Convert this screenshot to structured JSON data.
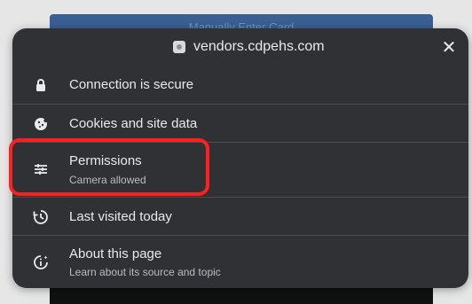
{
  "background": {
    "top_button_label": "Manually Enter Card"
  },
  "popup": {
    "site_name": "vendors.cdpehs.com",
    "close_icon": "close-icon",
    "rows": [
      {
        "title": "Connection is secure",
        "subtitle": ""
      },
      {
        "title": "Cookies and site data",
        "subtitle": ""
      },
      {
        "title": "Permissions",
        "subtitle": "Camera allowed"
      },
      {
        "title": "Last visited today",
        "subtitle": ""
      },
      {
        "title": "About this page",
        "subtitle": "Learn about its source and topic"
      }
    ]
  },
  "colors": {
    "popup_bg": "#303134",
    "text_primary": "#e8eaed",
    "text_secondary": "#b9bcc1",
    "divider": "#4a4c50",
    "highlight": "#ff2020",
    "background_blue": "#3a5f92"
  }
}
